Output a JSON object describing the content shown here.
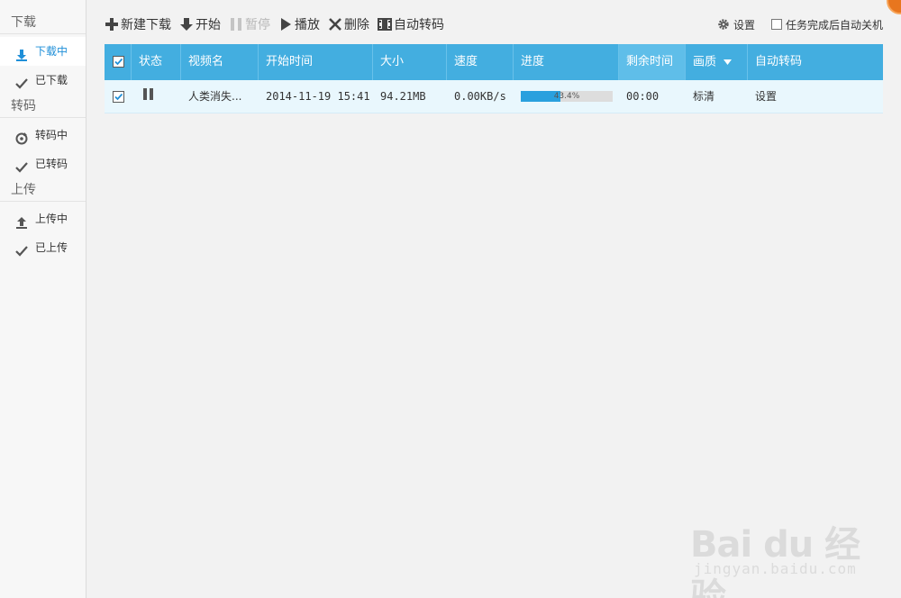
{
  "sidebar": {
    "sections": [
      {
        "title": "下载",
        "items": [
          {
            "label": "下载中",
            "icon": "download-arrow-icon",
            "active": true
          },
          {
            "label": "已下载",
            "icon": "checkmark-icon"
          }
        ]
      },
      {
        "title": "转码",
        "items": [
          {
            "label": "转码中",
            "icon": "refresh-icon"
          },
          {
            "label": "已转码",
            "icon": "checkmark-icon"
          }
        ]
      },
      {
        "title": "上传",
        "items": [
          {
            "label": "上传中",
            "icon": "upload-arrow-icon"
          },
          {
            "label": "已上传",
            "icon": "checkmark-icon"
          }
        ]
      }
    ]
  },
  "toolbar": {
    "new_download": "新建下载",
    "start": "开始",
    "pause": "暂停",
    "play": "播放",
    "delete": "删除",
    "auto_transcode": "自动转码",
    "settings": "设置",
    "shutdown_label": "任务完成后自动关机"
  },
  "table": {
    "headers": [
      "状态",
      "视频名",
      "开始时间",
      "大小",
      "速度",
      "进度",
      "剩余时间",
      "画质",
      "自动转码"
    ],
    "rows": [
      {
        "selected": true,
        "status_icon": "pause-icon",
        "name": "人类消失...",
        "start_time": "2014-11-19 15:41",
        "size": "94.21MB",
        "speed": "0.00KB/s",
        "progress_text": "43.4%",
        "progress_value": 0.434,
        "remaining": "00:00",
        "quality": "标清",
        "auto_transcode": "设置"
      }
    ]
  },
  "watermark": {
    "main": "Bai du 经验",
    "sub": "jingyan.baidu.com"
  },
  "colors": {
    "accent": "#43aee0",
    "progress": "#2aa0de",
    "row_bg": "#e9f7fd",
    "corner": "#e8761e"
  }
}
